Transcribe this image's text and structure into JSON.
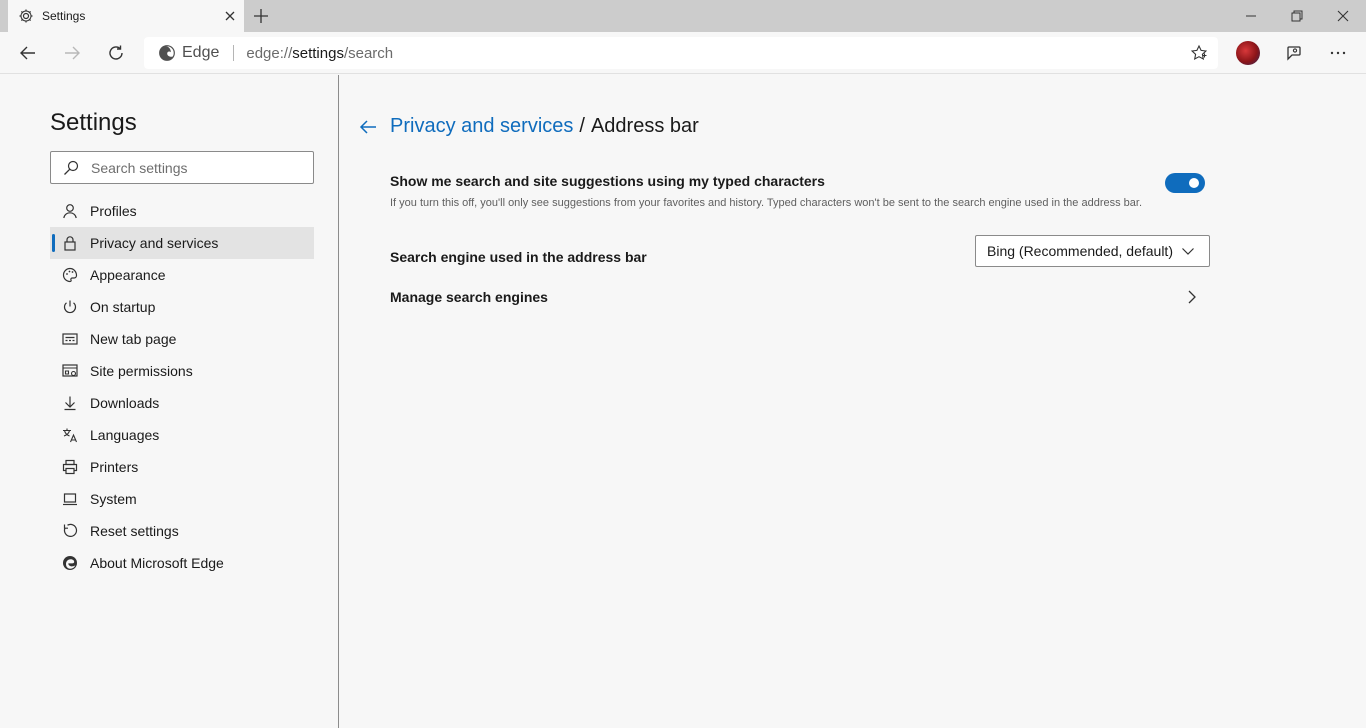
{
  "browser": {
    "tab_title": "Settings",
    "address_identity": "Edge",
    "url_scheme": "edge://",
    "url_host": "settings",
    "url_path": "/search"
  },
  "sidebar": {
    "title": "Settings",
    "search_placeholder": "Search settings",
    "items": [
      {
        "label": "Profiles",
        "icon": "profile-icon"
      },
      {
        "label": "Privacy and services",
        "icon": "lock-icon",
        "active": true
      },
      {
        "label": "Appearance",
        "icon": "palette-icon"
      },
      {
        "label": "On startup",
        "icon": "power-icon"
      },
      {
        "label": "New tab page",
        "icon": "newtab-page-icon"
      },
      {
        "label": "Site permissions",
        "icon": "site-permissions-icon"
      },
      {
        "label": "Downloads",
        "icon": "download-icon"
      },
      {
        "label": "Languages",
        "icon": "languages-icon"
      },
      {
        "label": "Printers",
        "icon": "printer-icon"
      },
      {
        "label": "System",
        "icon": "laptop-icon"
      },
      {
        "label": "Reset settings",
        "icon": "reset-icon"
      },
      {
        "label": "About Microsoft Edge",
        "icon": "edge-logo-icon"
      }
    ]
  },
  "main": {
    "breadcrumb_parent": "Privacy and services",
    "breadcrumb_separator": "/",
    "breadcrumb_current": "Address bar",
    "suggestions": {
      "title": "Show me search and site suggestions using my typed characters",
      "description": "If you turn this off, you'll only see suggestions from your favorites and history. Typed characters won't be sent to the search engine used in the address bar.",
      "enabled": true
    },
    "search_engine": {
      "label": "Search engine used in the address bar",
      "selected": "Bing (Recommended, default)"
    },
    "manage": {
      "label": "Manage search engines"
    }
  },
  "colors": {
    "accent": "#0f6cbd",
    "titlebar": "#cccccc",
    "background": "#f7f7f7"
  }
}
